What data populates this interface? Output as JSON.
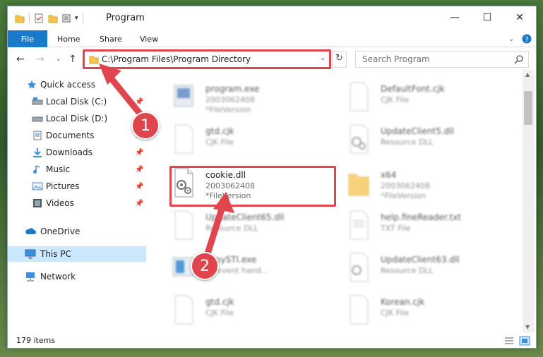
{
  "window": {
    "title": "Program",
    "minimize": "—",
    "maximize": "☐",
    "close": "✕"
  },
  "ribbon": {
    "file": "File",
    "home": "Home",
    "share": "Share",
    "view": "View"
  },
  "address": {
    "path": "C:\\Program Files\\Program Directory",
    "search_placeholder": "Search Program"
  },
  "nav": {
    "items": [
      {
        "label": "Quick access"
      },
      {
        "label": "Local Disk (C:)"
      },
      {
        "label": "Local Disk (D:)"
      },
      {
        "label": "Documents"
      },
      {
        "label": "Downloads"
      },
      {
        "label": "Music"
      },
      {
        "label": "Pictures"
      },
      {
        "label": "Videos"
      },
      {
        "label": "OneDrive"
      },
      {
        "label": "This PC"
      },
      {
        "label": "Network"
      }
    ]
  },
  "files": [
    {
      "name": "program.exe",
      "meta": "2003062408",
      "meta2": "*FileVersion"
    },
    {
      "name": "DefaultFont.cjk",
      "meta": "CJK File",
      "meta2": ""
    },
    {
      "name": "gtd.cjk",
      "meta": "CJK File",
      "meta2": ""
    },
    {
      "name": "UpdateClient5.dll",
      "meta": "Resource DLL",
      "meta2": ""
    },
    {
      "name": "cookie.dll",
      "meta": "2003062408",
      "meta2": "*FileVersion"
    },
    {
      "name": "x64",
      "meta": "2003062408",
      "meta2": "*FileVersion"
    },
    {
      "name": "UpdateClient65.dll",
      "meta": "Resource DLL",
      "meta2": ""
    },
    {
      "name": "help.fineReader.txt",
      "meta": "TXT File",
      "meta2": ""
    },
    {
      "name": "copySTI.exe",
      "meta": "sb event hand...",
      "meta2": ""
    },
    {
      "name": "UpdateClient63.dll",
      "meta": "Resource DLL",
      "meta2": ""
    },
    {
      "name": "gtd.cjk",
      "meta": "CJK File",
      "meta2": ""
    },
    {
      "name": "Korean.cjk",
      "meta": "CJK File",
      "meta2": ""
    }
  ],
  "status": {
    "count": "179 items"
  },
  "annotations": {
    "step1": "1",
    "step2": "2"
  },
  "colors": {
    "accent": "#1979ca",
    "highlight": "#e0454e",
    "selected": "#cce8ff"
  }
}
